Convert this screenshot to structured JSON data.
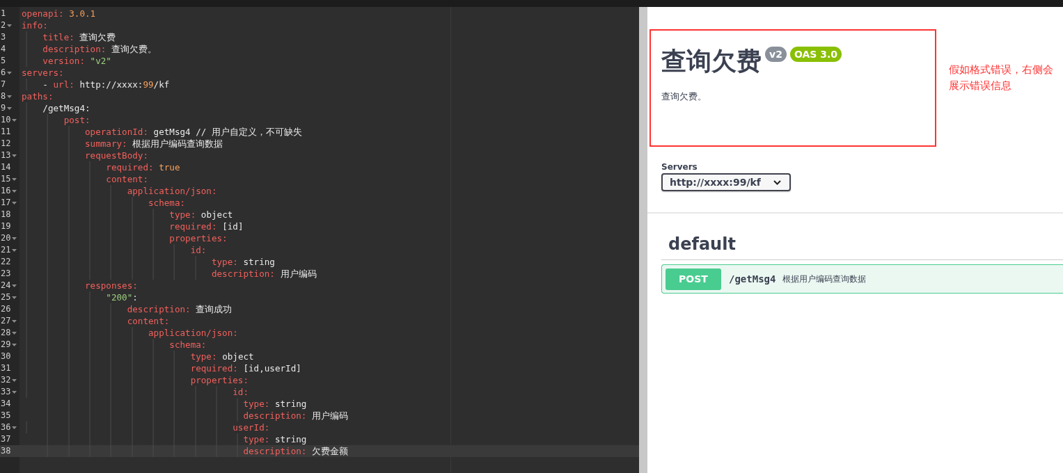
{
  "editor": {
    "lines": [
      {
        "number": "1",
        "foldable": false,
        "active": false,
        "tokens": [
          {
            "kind": "key",
            "text": "openapi:"
          },
          {
            "kind": "number",
            "text": " 3.0.1"
          }
        ]
      },
      {
        "number": "2",
        "foldable": true,
        "active": false,
        "tokens": [
          {
            "kind": "key",
            "text": "info:"
          }
        ]
      },
      {
        "number": "3",
        "foldable": false,
        "active": false,
        "tokens": [
          {
            "kind": "key",
            "text": "    title:"
          },
          {
            "kind": "plain",
            "text": " 查询欠费"
          }
        ]
      },
      {
        "number": "4",
        "foldable": false,
        "active": false,
        "tokens": [
          {
            "kind": "key",
            "text": "    description:"
          },
          {
            "kind": "plain",
            "text": " 查询欠费。"
          }
        ]
      },
      {
        "number": "5",
        "foldable": false,
        "active": false,
        "tokens": [
          {
            "kind": "key",
            "text": "    version:"
          },
          {
            "kind": "string",
            "text": " \"v2\""
          }
        ]
      },
      {
        "number": "6",
        "foldable": true,
        "active": false,
        "tokens": [
          {
            "kind": "key",
            "text": "servers:"
          }
        ]
      },
      {
        "number": "7",
        "foldable": false,
        "active": false,
        "tokens": [
          {
            "kind": "plain",
            "text": "    - "
          },
          {
            "kind": "key",
            "text": "url:"
          },
          {
            "kind": "plain",
            "text": " http://xxxx:"
          },
          {
            "kind": "number",
            "text": "99"
          },
          {
            "kind": "plain",
            "text": "/kf"
          }
        ]
      },
      {
        "number": "8",
        "foldable": true,
        "active": false,
        "tokens": [
          {
            "kind": "key",
            "text": "paths:"
          }
        ]
      },
      {
        "number": "9",
        "foldable": true,
        "active": false,
        "tokens": [
          {
            "kind": "plain",
            "text": "    /getMsg4:"
          }
        ]
      },
      {
        "number": "10",
        "foldable": true,
        "active": false,
        "tokens": [
          {
            "kind": "key",
            "text": "        post:"
          }
        ]
      },
      {
        "number": "11",
        "foldable": false,
        "active": false,
        "tokens": [
          {
            "kind": "key",
            "text": "            operationId:"
          },
          {
            "kind": "plain",
            "text": " getMsg4 // 用户自定义，不可缺失"
          }
        ]
      },
      {
        "number": "12",
        "foldable": false,
        "active": false,
        "tokens": [
          {
            "kind": "key",
            "text": "            summary:"
          },
          {
            "kind": "plain",
            "text": " 根据用户编码查询数据"
          }
        ]
      },
      {
        "number": "13",
        "foldable": true,
        "active": false,
        "tokens": [
          {
            "kind": "key",
            "text": "            requestBody:"
          }
        ]
      },
      {
        "number": "14",
        "foldable": false,
        "active": false,
        "tokens": [
          {
            "kind": "key",
            "text": "                required:"
          },
          {
            "kind": "number",
            "text": " true"
          }
        ]
      },
      {
        "number": "15",
        "foldable": true,
        "active": false,
        "tokens": [
          {
            "kind": "key",
            "text": "                content:"
          }
        ]
      },
      {
        "number": "16",
        "foldable": true,
        "active": false,
        "tokens": [
          {
            "kind": "key",
            "text": "                    application/json:"
          }
        ]
      },
      {
        "number": "17",
        "foldable": true,
        "active": false,
        "tokens": [
          {
            "kind": "key",
            "text": "                        schema:"
          }
        ]
      },
      {
        "number": "18",
        "foldable": false,
        "active": false,
        "tokens": [
          {
            "kind": "key",
            "text": "                            type:"
          },
          {
            "kind": "plain",
            "text": " object"
          }
        ]
      },
      {
        "number": "19",
        "foldable": false,
        "active": false,
        "tokens": [
          {
            "kind": "key",
            "text": "                            required:"
          },
          {
            "kind": "plain",
            "text": " [id]"
          }
        ]
      },
      {
        "number": "20",
        "foldable": true,
        "active": false,
        "tokens": [
          {
            "kind": "key",
            "text": "                            properties:"
          }
        ]
      },
      {
        "number": "21",
        "foldable": true,
        "active": false,
        "tokens": [
          {
            "kind": "key",
            "text": "                                id:"
          }
        ]
      },
      {
        "number": "22",
        "foldable": false,
        "active": false,
        "tokens": [
          {
            "kind": "key",
            "text": "                                    type:"
          },
          {
            "kind": "plain",
            "text": " string"
          }
        ]
      },
      {
        "number": "23",
        "foldable": false,
        "active": false,
        "tokens": [
          {
            "kind": "key",
            "text": "                                    description:"
          },
          {
            "kind": "plain",
            "text": " 用户编码"
          }
        ]
      },
      {
        "number": "24",
        "foldable": true,
        "active": false,
        "tokens": [
          {
            "kind": "key",
            "text": "            responses:"
          }
        ]
      },
      {
        "number": "25",
        "foldable": true,
        "active": false,
        "tokens": [
          {
            "kind": "string",
            "text": "                \"200\""
          },
          {
            "kind": "plain",
            "text": ":"
          }
        ]
      },
      {
        "number": "26",
        "foldable": false,
        "active": false,
        "tokens": [
          {
            "kind": "key",
            "text": "                    description:"
          },
          {
            "kind": "plain",
            "text": " 查询成功"
          }
        ]
      },
      {
        "number": "27",
        "foldable": true,
        "active": false,
        "tokens": [
          {
            "kind": "key",
            "text": "                    content:"
          }
        ]
      },
      {
        "number": "28",
        "foldable": true,
        "active": false,
        "tokens": [
          {
            "kind": "key",
            "text": "                        application/json:"
          }
        ]
      },
      {
        "number": "29",
        "foldable": true,
        "active": false,
        "tokens": [
          {
            "kind": "key",
            "text": "                            schema:"
          }
        ]
      },
      {
        "number": "30",
        "foldable": false,
        "active": false,
        "tokens": [
          {
            "kind": "key",
            "text": "                                type:"
          },
          {
            "kind": "plain",
            "text": " object"
          }
        ]
      },
      {
        "number": "31",
        "foldable": false,
        "active": false,
        "tokens": [
          {
            "kind": "key",
            "text": "                                required:"
          },
          {
            "kind": "plain",
            "text": " [id,userId]"
          }
        ]
      },
      {
        "number": "32",
        "foldable": true,
        "active": false,
        "tokens": [
          {
            "kind": "key",
            "text": "                                properties:"
          }
        ]
      },
      {
        "number": "33",
        "foldable": true,
        "active": false,
        "tokens": [
          {
            "kind": "key",
            "text": "                                        id:"
          }
        ]
      },
      {
        "number": "34",
        "foldable": false,
        "active": false,
        "tokens": [
          {
            "kind": "key",
            "text": "                                          type:"
          },
          {
            "kind": "plain",
            "text": " string"
          }
        ]
      },
      {
        "number": "35",
        "foldable": false,
        "active": false,
        "tokens": [
          {
            "kind": "key",
            "text": "                                          description:"
          },
          {
            "kind": "plain",
            "text": " 用户编码"
          }
        ]
      },
      {
        "number": "36",
        "foldable": true,
        "active": false,
        "tokens": [
          {
            "kind": "key",
            "text": "                                        userId:"
          }
        ]
      },
      {
        "number": "37",
        "foldable": false,
        "active": false,
        "tokens": [
          {
            "kind": "key",
            "text": "                                          type:"
          },
          {
            "kind": "plain",
            "text": " string"
          }
        ]
      },
      {
        "number": "38",
        "foldable": false,
        "active": true,
        "tokens": [
          {
            "kind": "key",
            "text": "                                          description:"
          },
          {
            "kind": "plain",
            "text": " 欠费金额"
          }
        ]
      }
    ]
  },
  "preview": {
    "title": "查询欠费",
    "badges": [
      {
        "text": "v2",
        "color": "#89909a"
      },
      {
        "text": "OAS 3.0",
        "color": "#89bf04"
      }
    ],
    "description": "查询欠费。",
    "annotation": "假如格式错误，右侧会展示错误信息",
    "servers": {
      "label": "Servers",
      "value": "http://xxxx:99/kf"
    },
    "tag": "default",
    "operations": [
      {
        "method": "POST",
        "path": "/getMsg4",
        "summary": "根据用户编码查询数据"
      }
    ]
  }
}
